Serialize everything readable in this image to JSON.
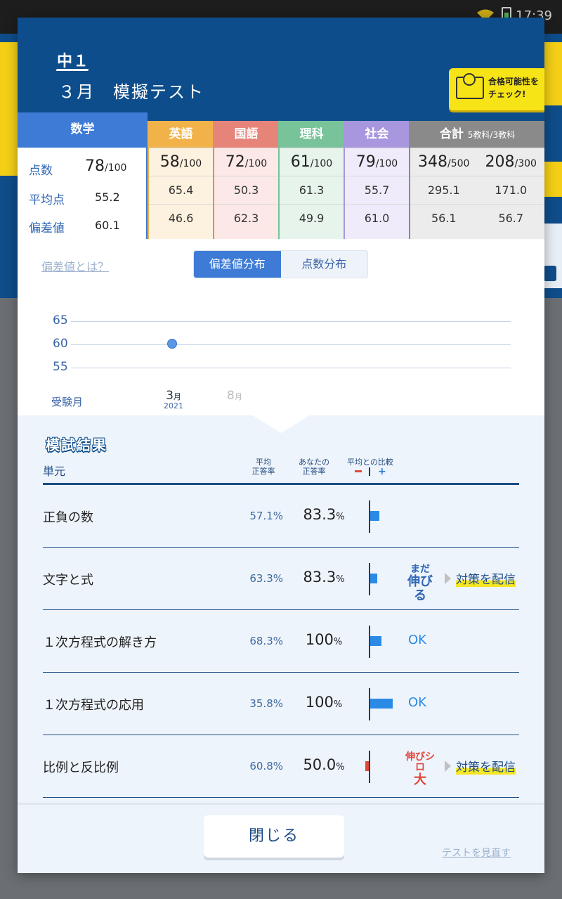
{
  "status_bar": {
    "time": "17:39"
  },
  "header": {
    "grade": "中１",
    "title": "３月　模擬テスト",
    "check_button": "合格可能性をチェック!"
  },
  "scores": {
    "row_labels": [
      "点数",
      "平均点",
      "偏差値"
    ],
    "math": {
      "name": "数学",
      "score": "78",
      "max": "/100",
      "average": "55.2",
      "deviation": "60.1"
    },
    "subjects": [
      {
        "name": "英語",
        "score": "58",
        "max": "/100",
        "average": "65.4",
        "deviation": "46.6"
      },
      {
        "name": "国語",
        "score": "72",
        "max": "/100",
        "average": "50.3",
        "deviation": "62.3"
      },
      {
        "name": "理科",
        "score": "61",
        "max": "/100",
        "average": "61.3",
        "deviation": "49.9"
      },
      {
        "name": "社会",
        "score": "79",
        "max": "/100",
        "average": "55.7",
        "deviation": "61.0"
      }
    ],
    "total": {
      "name": "合計",
      "sub": "5教科/3教科",
      "five": {
        "score": "348",
        "max": "/500",
        "average": "295.1",
        "deviation": "56.1"
      },
      "three": {
        "score": "208",
        "max": "/300",
        "average": "171.0",
        "deviation": "56.7"
      }
    }
  },
  "chart_section": {
    "about_link": "偏差値とは？",
    "tabs": [
      "偏差値分布",
      "点数分布"
    ],
    "active_tab": 0
  },
  "chart_data": {
    "type": "line",
    "y_ticks": [
      "65",
      "60",
      "55"
    ],
    "ylim": [
      55,
      65
    ],
    "xlabel": "受験月",
    "x_months": [
      {
        "month": "3",
        "unit": "月",
        "year": "2021"
      },
      {
        "month": "8",
        "unit": "月",
        "year": ""
      }
    ],
    "series": [
      {
        "values": [
          60.1,
          null
        ]
      }
    ]
  },
  "results": {
    "title": "模試結果",
    "col_unit": "単元",
    "col_avg": [
      "平均",
      "正答率"
    ],
    "col_you": [
      "あなたの",
      "正答率"
    ],
    "col_cmp": "平均との比較",
    "rows": [
      {
        "name": "正負の数",
        "avg": "57.1%",
        "you_value": "83.3",
        "you_unit": "%",
        "diff": 26.2,
        "status": "bar-only"
      },
      {
        "name": "文字と式",
        "avg": "63.3%",
        "you_value": "83.3",
        "you_unit": "%",
        "diff": 20.0,
        "status": "still",
        "badge_small": "まだ",
        "badge_big": "伸びる",
        "action": "対策を配信"
      },
      {
        "name": "１次方程式の解き方",
        "avg": "68.3%",
        "you_value": "100",
        "you_unit": "%",
        "diff": 31.7,
        "status": "ok",
        "ok": "OK"
      },
      {
        "name": "１次方程式の応用",
        "avg": "35.8%",
        "you_value": "100",
        "you_unit": "%",
        "diff": 64.2,
        "status": "ok",
        "ok": "OK"
      },
      {
        "name": "比例と反比例",
        "avg": "60.8%",
        "you_value": "50.0",
        "you_unit": "%",
        "diff": -10.8,
        "status": "grow",
        "badge_small": "伸びシロ",
        "badge_big": "大",
        "action": "対策を配信"
      }
    ]
  },
  "footer": {
    "close": "閉じる",
    "review": "テストを見直す"
  }
}
